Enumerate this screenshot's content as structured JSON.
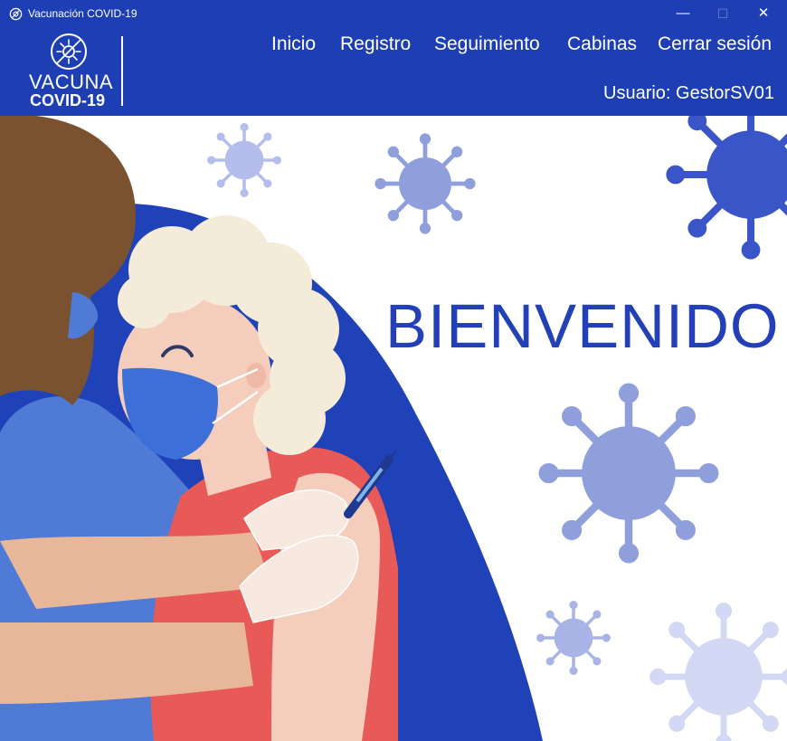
{
  "window": {
    "title": "Vacunación COVID-19"
  },
  "logo": {
    "line1": "VACUNA",
    "line2": "COVID-19"
  },
  "nav": [
    {
      "label": "Inicio"
    },
    {
      "label": "Registro"
    },
    {
      "label": "Seguimiento"
    },
    {
      "label": "Cabinas"
    },
    {
      "label": "Cerrar sesión"
    }
  ],
  "user": {
    "label": "Usuario: GestorSV01"
  },
  "main": {
    "welcome": "BIENVENIDO"
  },
  "colors": {
    "brand_blue": "#1e3fb4",
    "welcome_text": "#2340b8",
    "virus_light": "#8f9fdc",
    "virus_dark": "#3a55c7"
  }
}
